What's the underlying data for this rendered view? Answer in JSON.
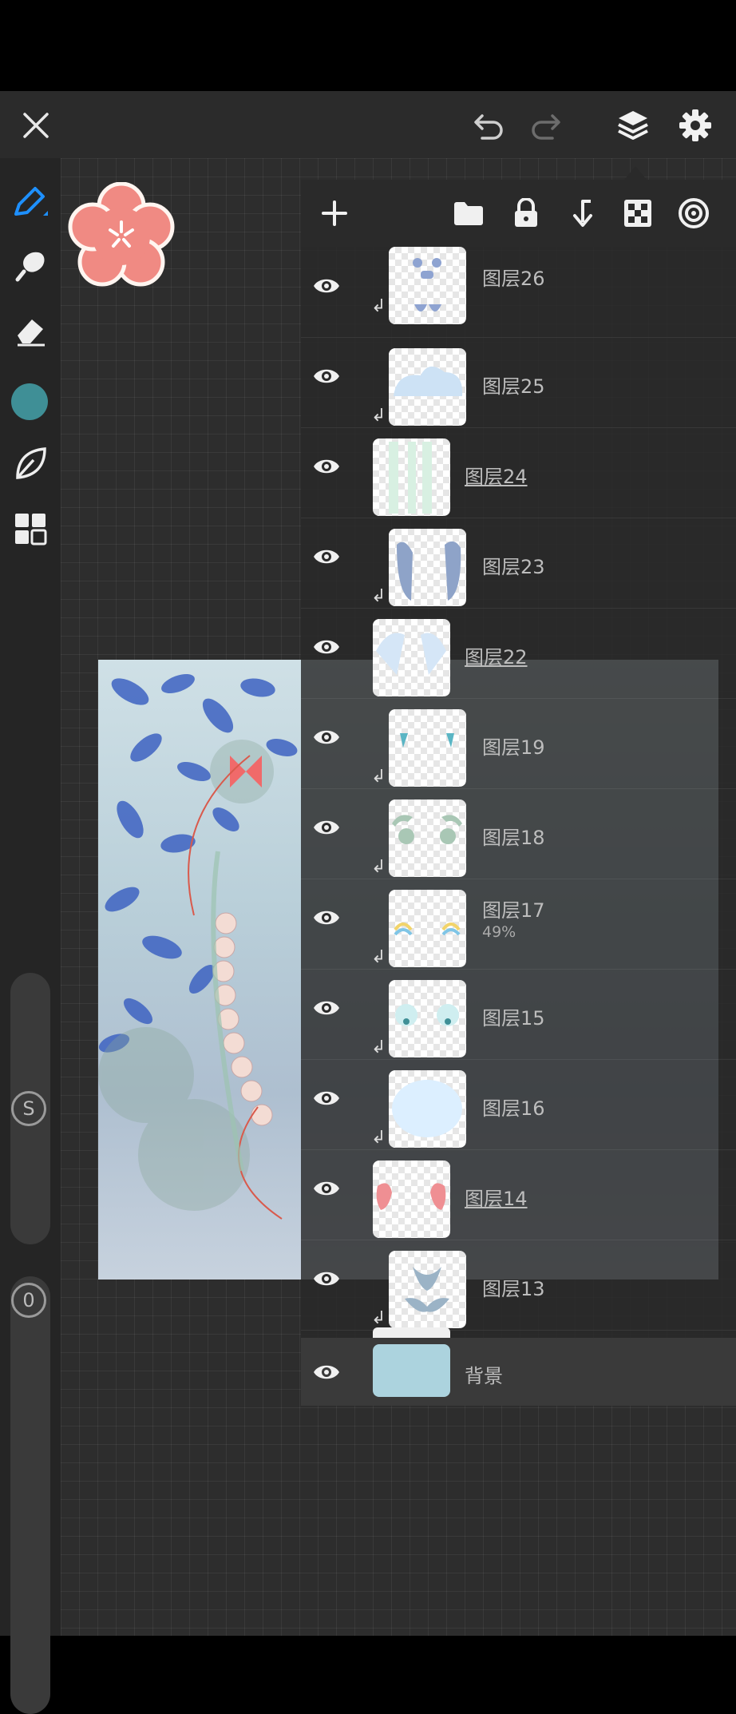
{
  "colors": {
    "accent": "#1e90ff",
    "current_color": "#3f8f96",
    "sticker": "#f08a83",
    "background_layer": "#acd3de"
  },
  "toolbar": {
    "close_icon": "close-icon",
    "undo_icon": "undo-icon",
    "redo_icon": "redo-icon",
    "layers_icon": "layers-icon",
    "settings_icon": "gear-icon"
  },
  "left_tools": [
    "brush-icon",
    "smudge-icon",
    "eraser-icon",
    "color-swatch",
    "leaf-icon",
    "grid-icon"
  ],
  "sliders": {
    "size_label": "S",
    "opacity_label": "0"
  },
  "layers_panel": {
    "header_icons": [
      "add-icon",
      "folder-icon",
      "lock-icon",
      "clip-merge-icon",
      "checker-icon",
      "target-icon"
    ],
    "layers": [
      {
        "name": "图层26",
        "clipped": true,
        "group": false,
        "opacity": ""
      },
      {
        "name": "图层25",
        "clipped": true,
        "group": false,
        "opacity": ""
      },
      {
        "name": "图层24",
        "clipped": false,
        "group": true,
        "opacity": ""
      },
      {
        "name": "图层23",
        "clipped": true,
        "group": false,
        "opacity": ""
      },
      {
        "name": "图层22",
        "clipped": false,
        "group": true,
        "opacity": ""
      },
      {
        "name": "图层19",
        "clipped": true,
        "group": false,
        "opacity": ""
      },
      {
        "name": "图层18",
        "clipped": true,
        "group": false,
        "opacity": ""
      },
      {
        "name": "图层17",
        "clipped": true,
        "group": false,
        "opacity": "49%"
      },
      {
        "name": "图层15",
        "clipped": true,
        "group": false,
        "opacity": ""
      },
      {
        "name": "图层16",
        "clipped": true,
        "group": false,
        "opacity": ""
      },
      {
        "name": "图层14",
        "clipped": false,
        "group": true,
        "opacity": ""
      },
      {
        "name": "图层13",
        "clipped": true,
        "group": false,
        "opacity": ""
      }
    ],
    "background_layer": {
      "name": "背景"
    }
  }
}
